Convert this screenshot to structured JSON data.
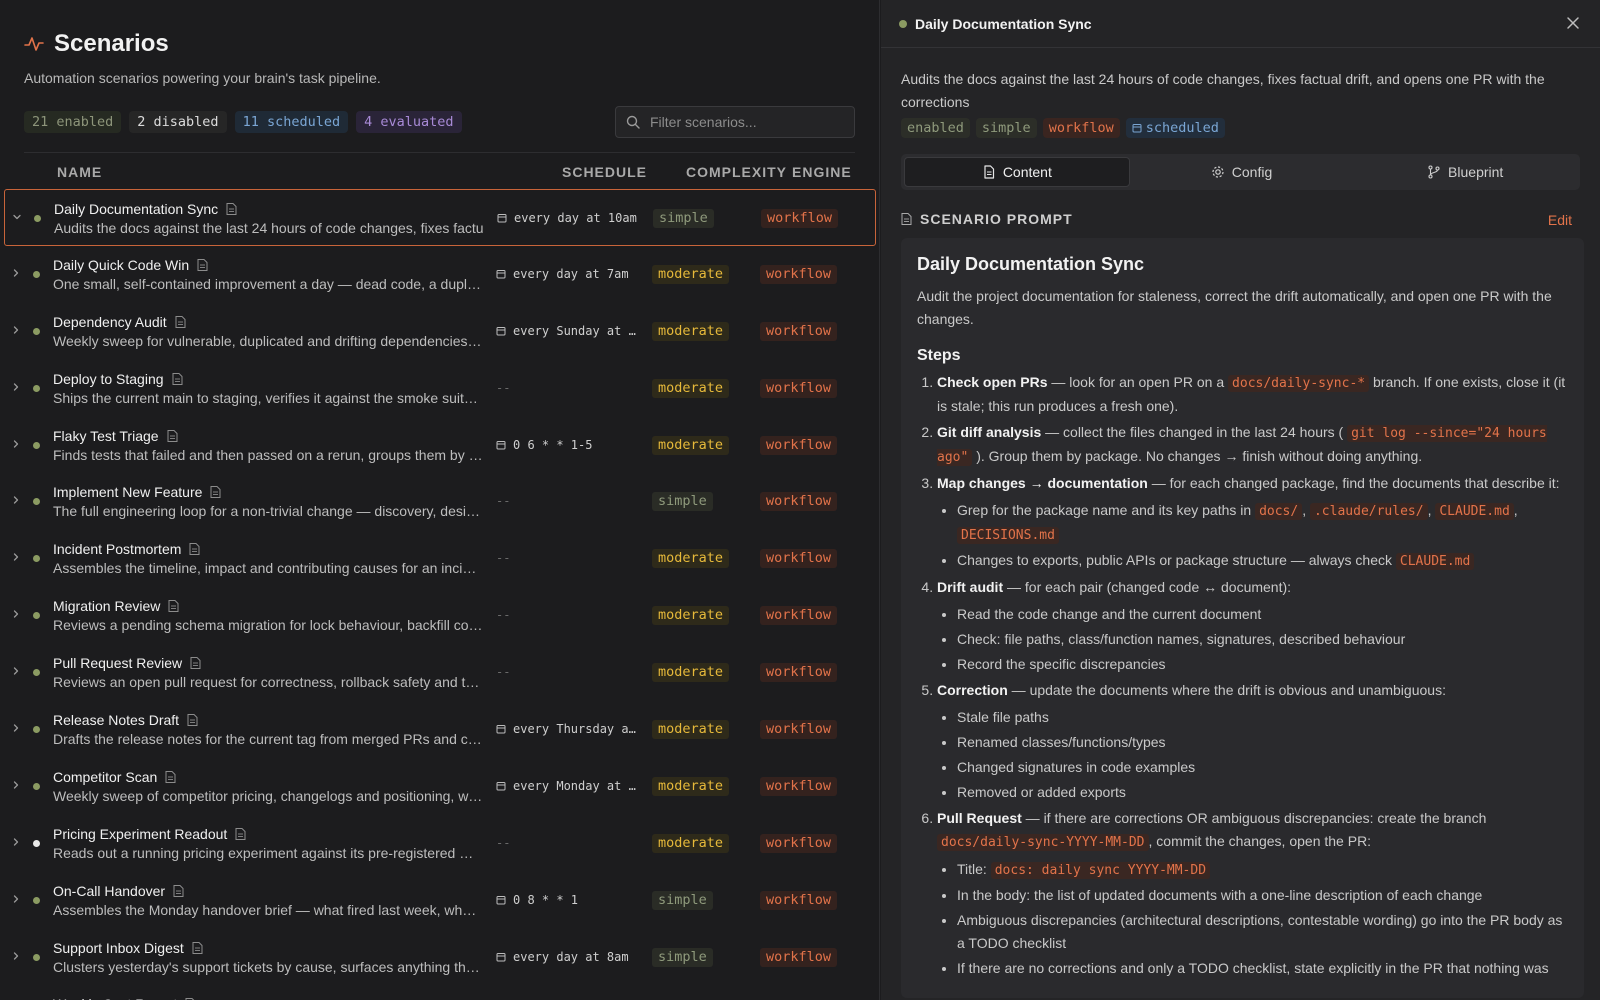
{
  "header": {
    "title": "Scenarios",
    "subtitle": "Automation scenarios powering your brain's task pipeline."
  },
  "stats": {
    "enabled": "21 enabled",
    "disabled": "2 disabled",
    "scheduled": "11 scheduled",
    "evaluated": "4 evaluated"
  },
  "search": {
    "placeholder": "Filter scenarios..."
  },
  "table": {
    "headers": {
      "name": "NAME",
      "schedule": "SCHEDULE",
      "complexity": "COMPLEXITY",
      "engine": "ENGINE"
    },
    "rows": [
      {
        "name": "Daily Documentation Sync",
        "desc": "Audits the docs against the last 24 hours of code changes, fixes factu",
        "schedule": "every day at 10am",
        "complexity": "simple",
        "engine": "workflow"
      },
      {
        "name": "Daily Quick Code Win",
        "desc": "One small, self-contained improvement a day — dead code, a dupl…",
        "schedule": "every day at 7am",
        "complexity": "moderate",
        "engine": "workflow"
      },
      {
        "name": "Dependency Audit",
        "desc": "Weekly sweep for vulnerable, duplicated and drifting dependencies…",
        "schedule": "every Sunday at …",
        "complexity": "moderate",
        "engine": "workflow"
      },
      {
        "name": "Deploy to Staging",
        "desc": "Ships the current main to staging, verifies it against the smoke suit…",
        "schedule": "--",
        "complexity": "moderate",
        "engine": "workflow"
      },
      {
        "name": "Flaky Test Triage",
        "desc": "Finds tests that failed and then passed on a rerun, groups them by …",
        "schedule": "0 6 * * 1-5",
        "complexity": "moderate",
        "engine": "workflow"
      },
      {
        "name": "Implement New Feature",
        "desc": "The full engineering loop for a non-trivial change — discovery, desi…",
        "schedule": "--",
        "complexity": "simple",
        "engine": "workflow"
      },
      {
        "name": "Incident Postmortem",
        "desc": "Assembles the timeline, impact and contributing causes for an inci…",
        "schedule": "--",
        "complexity": "moderate",
        "engine": "workflow"
      },
      {
        "name": "Migration Review",
        "desc": "Reviews a pending schema migration for lock behaviour, backfill co…",
        "schedule": "--",
        "complexity": "moderate",
        "engine": "workflow"
      },
      {
        "name": "Pull Request Review",
        "desc": "Reviews an open pull request for correctness, rollback safety and t…",
        "schedule": "--",
        "complexity": "moderate",
        "engine": "workflow"
      },
      {
        "name": "Release Notes Draft",
        "desc": "Drafts the release notes for the current tag from merged PRs and c…",
        "schedule": "every Thursday a…",
        "complexity": "moderate",
        "engine": "workflow"
      },
      {
        "name": "Competitor Scan",
        "desc": "Weekly sweep of competitor pricing, changelogs and positioning, w…",
        "schedule": "every Monday at …",
        "complexity": "moderate",
        "engine": "workflow"
      },
      {
        "name": "Pricing Experiment Readout",
        "desc": "Reads out a running pricing experiment against its pre-registered …",
        "schedule": "--",
        "complexity": "moderate",
        "engine": "workflow"
      },
      {
        "name": "On-Call Handover",
        "desc": "Assembles the Monday handover brief — what fired last week, wh…",
        "schedule": "0 8 * * 1",
        "complexity": "simple",
        "engine": "workflow"
      },
      {
        "name": "Support Inbox Digest",
        "desc": "Clusters yesterday's support tickets by cause, surfaces anything th…",
        "schedule": "every day at 8am",
        "complexity": "simple",
        "engine": "workflow"
      },
      {
        "name": "Weekly Cost Report",
        "desc": "",
        "schedule": "",
        "complexity": "",
        "engine": ""
      }
    ]
  },
  "detail": {
    "title": "Daily Documentation Sync",
    "description": "Audits the docs against the last 24 hours of code changes, fixes factual drift, and opens one PR with the corrections",
    "tags": {
      "enabled": "enabled",
      "complexity": "simple",
      "engine": "workflow",
      "scheduled": "scheduled"
    },
    "tabs": {
      "content": "Content",
      "config": "Config",
      "blueprint": "Blueprint"
    },
    "prompt_label": "SCENARIO PROMPT",
    "edit_label": "Edit",
    "doc": {
      "title": "Daily Documentation Sync",
      "lead": "Audit the project documentation for staleness, correct the drift automatically, and open one PR with the changes.",
      "steps_title": "Steps",
      "s1_b": "Check open PRs",
      "s1_a": " — look for an open PR on a ",
      "s1_code": "docs/daily-sync-*",
      "s1_c": " branch. If one exists, close it (it is stale; this run produces a fresh one).",
      "s2_b": "Git diff analysis",
      "s2_a": " — collect the files changed in the last 24 hours ( ",
      "s2_code": "git log --since=\"24 hours ago\"",
      "s2_c": " ). Group them by package. No changes → finish without doing anything.",
      "s3_b": "Map changes → documentation",
      "s3_a": " — for each changed package, find the documents that describe it:",
      "s3_i1_a": "Grep for the package name and its key paths in ",
      "s3_i1_c1": "docs/",
      "s3_i1_c2": ".claude/rules/",
      "s3_i1_c3": "CLAUDE.md",
      "s3_i1_c4": "DECISIONS.md",
      "s3_i2_a": "Changes to exports, public APIs or package structure — always check ",
      "s3_i2_code": "CLAUDE.md",
      "s4_b": "Drift audit",
      "s4_a": " — for each pair (changed code ↔ document):",
      "s4_i1": "Read the code change and the current document",
      "s4_i2": "Check: file paths, class/function names, signatures, described behaviour",
      "s4_i3": "Record the specific discrepancies",
      "s5_b": "Correction",
      "s5_a": " — update the documents where the drift is obvious and unambiguous:",
      "s5_i1": "Stale file paths",
      "s5_i2": "Renamed classes/functions/types",
      "s5_i3": "Changed signatures in code examples",
      "s5_i4": "Removed or added exports",
      "s6_b": "Pull Request",
      "s6_a": " — if there are corrections OR ambiguous discrepancies: create the branch ",
      "s6_code": "docs/daily-sync-YYYY-MM-DD",
      "s6_c": ", commit the changes, open the PR:",
      "s6_i1_a": "Title: ",
      "s6_i1_code": "docs: daily sync YYYY-MM-DD",
      "s6_i2": "In the body: the list of updated documents with a one-line description of each change",
      "s6_i3": "Ambiguous discrepancies (architectural descriptions, contestable wording) go into the PR body as a TODO checklist",
      "s6_i4": "If there are no corrections and only a TODO checklist, state explicitly in the PR that nothing was"
    }
  },
  "colors": {
    "accent": "#e2734a",
    "enabled_dot": "#8b9b62",
    "moderate": "#e6b93a",
    "scheduled": "#7aa6d4",
    "evaluated": "#a88ad6"
  }
}
